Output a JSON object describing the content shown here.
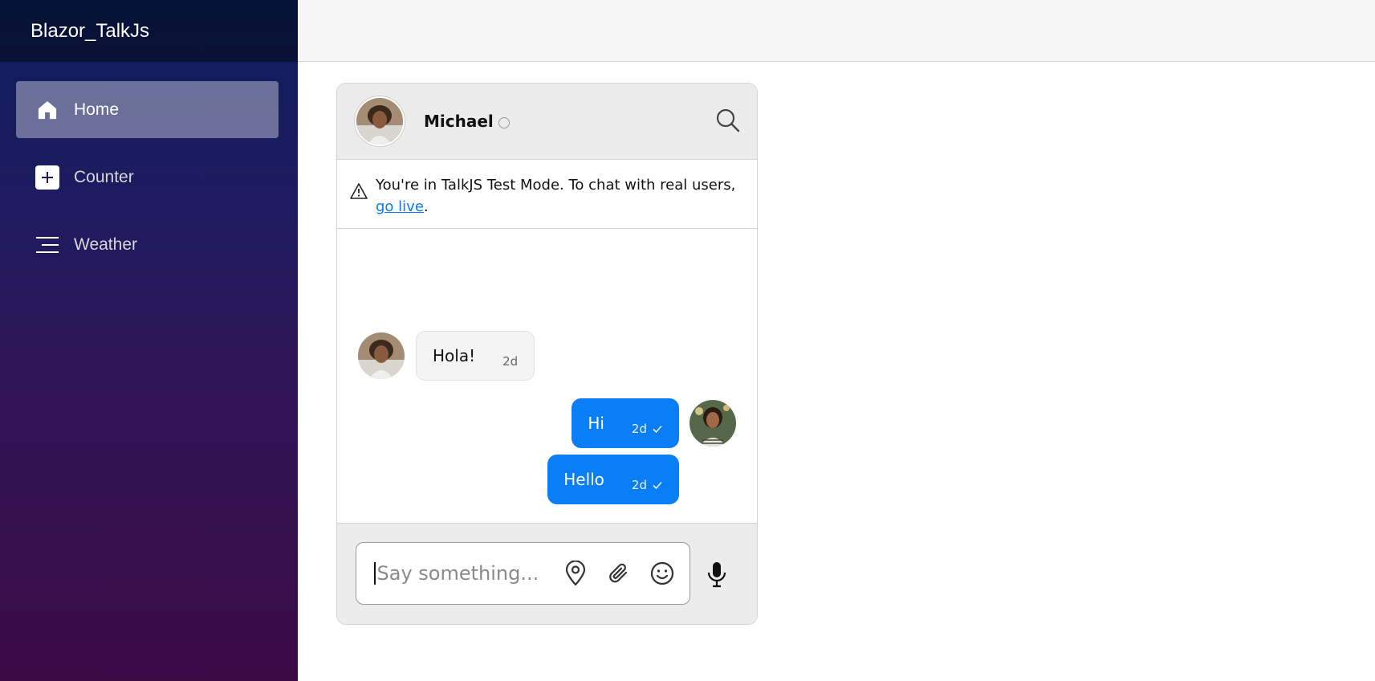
{
  "app": {
    "brand": "Blazor_TalkJs"
  },
  "sidebar": {
    "items": [
      {
        "label": "Home",
        "icon": "home-icon",
        "active": true
      },
      {
        "label": "Counter",
        "icon": "plus-square-icon",
        "active": false
      },
      {
        "label": "Weather",
        "icon": "list-lines-icon",
        "active": false
      }
    ]
  },
  "chat": {
    "header": {
      "name": "Michael",
      "status": "offline"
    },
    "notice": {
      "text": "You're in TalkJS Test Mode. To chat with real users, ",
      "link": "go live",
      "suffix": "."
    },
    "messages": [
      {
        "from": "Michael",
        "text": "Hola!",
        "time": "2d",
        "direction": "incoming"
      },
      {
        "from": "me",
        "text": "Hi",
        "time": "2d",
        "direction": "outgoing",
        "read": true
      },
      {
        "from": "me",
        "text": "Hello",
        "time": "2d",
        "direction": "outgoing",
        "read": true
      }
    ],
    "composer": {
      "placeholder": "Say something..."
    }
  },
  "colors": {
    "accent": "#0a7ef7",
    "link": "#0a7cf0",
    "sidebar_top": "#0b1e5c",
    "sidebar_bottom": "#3b0a45"
  }
}
